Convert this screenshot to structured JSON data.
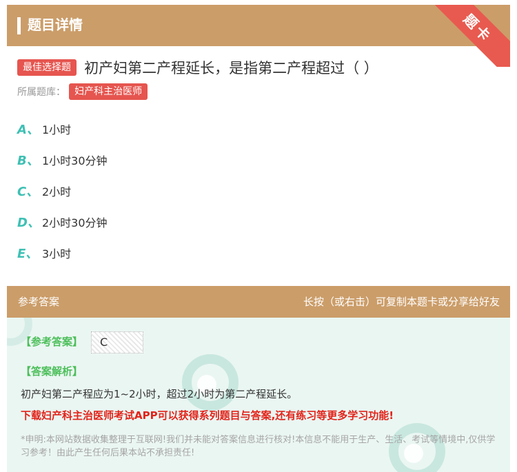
{
  "header": {
    "title": "题目详情",
    "corner_badge": "题卡"
  },
  "question": {
    "type_tag": "最佳选择题",
    "text": "初产妇第二产程延长，是指第二产程超过（ ）",
    "bank_label": "所属题库：",
    "bank_name": "妇产科主治医师",
    "options": [
      {
        "letter": "A、",
        "text": "1小时"
      },
      {
        "letter": "B、",
        "text": "1小时30分钟"
      },
      {
        "letter": "C、",
        "text": "2小时"
      },
      {
        "letter": "D、",
        "text": "2小时30分钟"
      },
      {
        "letter": "E、",
        "text": "3小时"
      }
    ]
  },
  "answer_section": {
    "title": "参考答案",
    "hint": "长按（或右击）可复制本题卡或分享给好友",
    "answer_label": "【参考答案】",
    "answer_value": "C",
    "explanation_label": "【答案解析】",
    "explanation_text": "初产妇第二产程应为1~2小时，超过2小时为第二产程延长。",
    "promo_text": "下载妇产科主治医师考试APP可以获得系列题目与答案,还有练习等更多学习功能!",
    "disclaimer": "*申明:本网站数据收集整理于互联网!我们并未能对答案信息进行核对!本信息不能用于生产、生活、考试等情境中,仅供学习参考！由此产生任何后果本站不承担责任!"
  },
  "colors": {
    "header_bg": "#cb9d69",
    "accent_red": "#e6554f",
    "option_letter": "#3fc0b4",
    "answer_green": "#4cbf5a",
    "answer_bg": "#eaf6f2"
  }
}
